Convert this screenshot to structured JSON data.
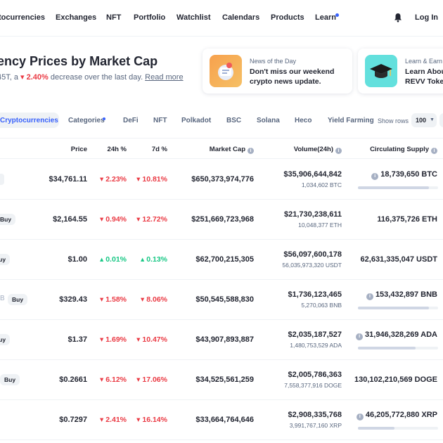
{
  "nav": {
    "items": [
      "tocurrencies",
      "Exchanges",
      "NFT",
      "Portfolio",
      "Watchlist",
      "Calendars",
      "Products",
      "Learn"
    ],
    "login": "Log In"
  },
  "hero": {
    "title": "ency Prices by Market Cap",
    "sub_prefix": "45T, a ",
    "change": "2.40%",
    "sub_suffix": " decrease over the last day.",
    "read_more": "Read more"
  },
  "cards": [
    {
      "kicker": "News of the Day",
      "line1": "Don't miss our weekend",
      "line2": "crypto news update.",
      "icon": "news-illustration-icon"
    },
    {
      "kicker": "Learn & Earn",
      "line1": "Learn About",
      "line2": "REVV Token",
      "icon": "graduation-cap-icon"
    }
  ],
  "tabs": {
    "active": "Cryptocurrencies",
    "items": [
      "Categories",
      "DeFi",
      "NFT",
      "Polkadot",
      "BSC",
      "Solana",
      "Heco",
      "Yield Farming"
    ],
    "show_rows_label": "Show rows",
    "rows_value": "100"
  },
  "table": {
    "headers": {
      "price": "Price",
      "h24": "24h %",
      "d7": "7d %",
      "mcap": "Market Cap",
      "volume": "Volume(24h)",
      "supply": "Circulating Supply"
    },
    "buy_label": "Buy",
    "rows": [
      {
        "price": "$34,761.11",
        "h24": "2.23%",
        "h24_dir": "down",
        "d7": "10.81%",
        "d7_dir": "down",
        "mcap": "$650,373,974,776",
        "vol": "$35,906,644,842",
        "vol_sub": "1,034,602 BTC",
        "supply": "18,739,650 BTC",
        "supply_info": true,
        "bar": 0.89
      },
      {
        "price": "$2,164.55",
        "h24": "0.94%",
        "h24_dir": "down",
        "d7": "12.72%",
        "d7_dir": "down",
        "mcap": "$251,669,723,968",
        "vol": "$21,730,238,611",
        "vol_sub": "10,048,377 ETH",
        "supply": "116,375,726 ETH",
        "supply_info": false,
        "bar": null
      },
      {
        "price": "$1.00",
        "h24": "0.01%",
        "h24_dir": "up",
        "d7": "0.13%",
        "d7_dir": "up",
        "mcap": "$62,700,215,305",
        "vol": "$56,097,600,178",
        "vol_sub": "56,035,973,320 USDT",
        "supply": "62,631,335,047 USDT",
        "supply_info": false,
        "bar": null
      },
      {
        "price": "$329.43",
        "h24": "1.58%",
        "h24_dir": "down",
        "d7": "8.06%",
        "d7_dir": "down",
        "mcap": "$50,545,588,830",
        "vol": "$1,736,123,465",
        "vol_sub": "5,270,063 BNB",
        "supply": "153,432,897 BNB",
        "supply_info": true,
        "bar": 0.89
      },
      {
        "price": "$1.37",
        "h24": "1.69%",
        "h24_dir": "down",
        "d7": "10.47%",
        "d7_dir": "down",
        "mcap": "$43,907,893,887",
        "vol": "$2,035,187,527",
        "vol_sub": "1,480,753,529 ADA",
        "supply": "31,946,328,269 ADA",
        "supply_info": true,
        "bar": 0.72
      },
      {
        "price": "$0.2661",
        "h24": "6.12%",
        "h24_dir": "down",
        "d7": "17.06%",
        "d7_dir": "down",
        "mcap": "$34,525,561,259",
        "vol": "$2,005,786,363",
        "vol_sub": "7,558,377,916 DOGE",
        "supply": "130,102,210,569 DOGE",
        "supply_info": false,
        "bar": null
      },
      {
        "price": "$0.7297",
        "h24": "2.41%",
        "h24_dir": "down",
        "d7": "16.14%",
        "d7_dir": "down",
        "mcap": "$33,664,764,646",
        "vol": "$2,908,335,768",
        "vol_sub": "3,991,767,160 XRP",
        "supply": "46,205,772,880 XRP",
        "supply_info": true,
        "bar": 0.46
      }
    ],
    "edge_ticker_row4": "B"
  },
  "colors": {
    "accent": "#3861fb",
    "negative": "#ea3943",
    "positive": "#16c784",
    "muted": "#58667e"
  }
}
